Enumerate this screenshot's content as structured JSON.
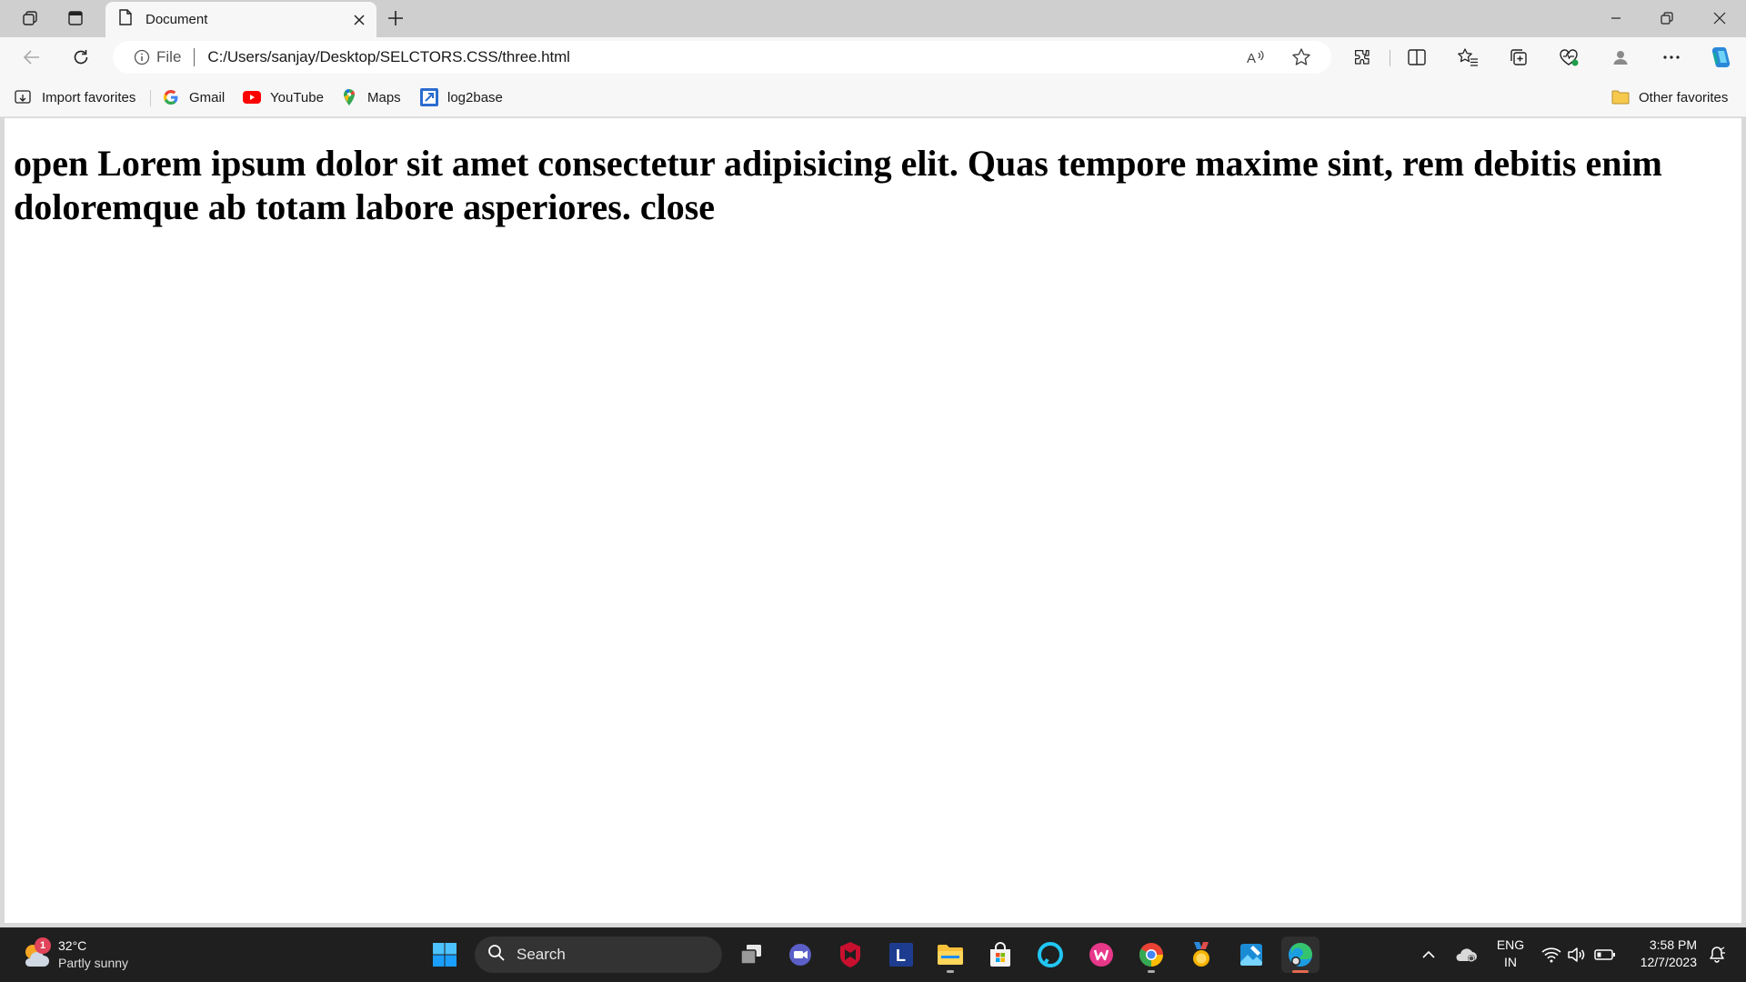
{
  "browser": {
    "tab": {
      "title": "Document"
    },
    "address": {
      "scheme_label": "File",
      "url": "C:/Users/sanjay/Desktop/SELCTORS.CSS/three.html"
    },
    "favorites": [
      {
        "label": "Import favorites",
        "icon": "import-favorites-icon"
      },
      {
        "label": "Gmail",
        "icon": "google-icon"
      },
      {
        "label": "YouTube",
        "icon": "youtube-icon"
      },
      {
        "label": "Maps",
        "icon": "maps-icon"
      },
      {
        "label": "log2base",
        "icon": "log2base-icon"
      }
    ],
    "other_favorites": "Other favorites"
  },
  "page": {
    "heading": "open Lorem ipsum dolor sit amet consectetur adipisicing elit. Quas tempore maxime sint, rem debitis enim doloremque ab totam labore asperiores. close"
  },
  "taskbar": {
    "weather": {
      "temp": "32°C",
      "desc": "Partly sunny",
      "badge": "1"
    },
    "search_label": "Search",
    "language": {
      "line1": "ENG",
      "line2": "IN"
    },
    "clock": {
      "time": "3:58 PM",
      "date": "12/7/2023"
    }
  },
  "colors": {
    "tab_bar": "#cfcfcf",
    "toolbar": "#f7f7f7",
    "taskbar": "#1f1f1f",
    "copilot_accent": "#2b88d8",
    "youtube_red": "#ff0000"
  }
}
